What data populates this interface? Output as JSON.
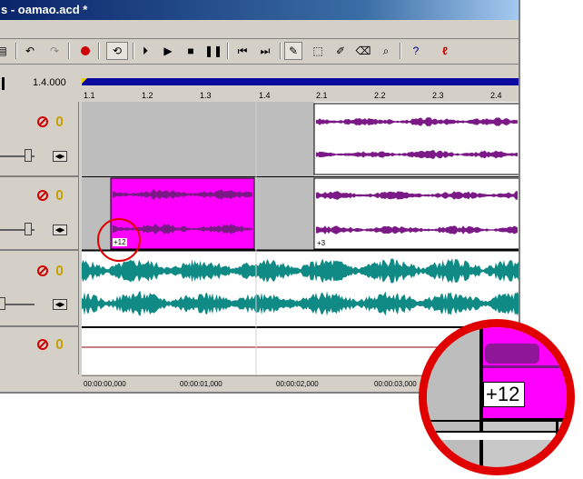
{
  "title": "s - oamao.acd *",
  "tempo": "1.4.000",
  "ruler_ticks": [
    "1.1",
    "1.2",
    "1.3",
    "1.4",
    "2.1",
    "2.2",
    "2.3",
    "2.4"
  ],
  "time_labels": [
    "00:00:00,000",
    "00:00:01,000",
    "00:00:02,000",
    "00:00:03,000"
  ],
  "clip_labels": [
    "+12",
    "+3"
  ],
  "zoom_label": "+12",
  "colors": {
    "purple": "#7b1a86",
    "magenta": "#ff00ff",
    "teal": "#0f8a84",
    "highlight": "#e00000"
  },
  "icons": [
    "undo-icon",
    "redo-icon",
    "record-icon",
    "loop-icon",
    "play-from-start-icon",
    "play-icon",
    "stop-icon",
    "pause-icon",
    "go-to-start-icon",
    "go-to-end-icon",
    "draw-tool-icon",
    "selection-tool-icon",
    "envelope-tool-icon",
    "erase-tool-icon",
    "zoom-tool-icon",
    "help-icon",
    "red-swirl-icon"
  ]
}
